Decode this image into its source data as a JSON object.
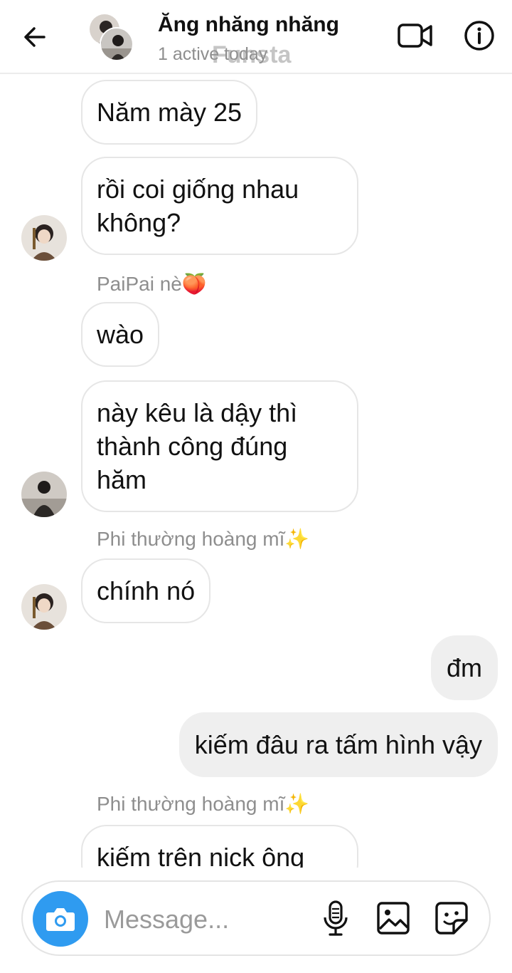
{
  "header": {
    "title": "Ăng nhăng nhăng",
    "status": "1 active today",
    "watermark": "Funsta",
    "icons": {
      "back": "arrow-left-icon",
      "video": "video-camera-icon",
      "info": "info-icon"
    }
  },
  "messages": [
    {
      "text_lines": [
        "Năm mày 25"
      ],
      "direction": "incoming"
    },
    {
      "text_lines": [
        "rồi coi giống nhau",
        "không?"
      ],
      "direction": "incoming"
    },
    {
      "sender": "PaiPai nè🍑"
    },
    {
      "text_lines": [
        "wào"
      ],
      "direction": "incoming"
    },
    {
      "text_lines": [
        "này kêu là dậy thì",
        "thành công đúng",
        "hăm"
      ],
      "direction": "incoming"
    },
    {
      "sender": "Phi thường hoàng mĩ✨"
    },
    {
      "text_lines": [
        "chính nó"
      ],
      "direction": "incoming"
    },
    {
      "text_lines": [
        "đm"
      ],
      "direction": "outgoing"
    },
    {
      "text_lines": [
        "kiếm đâu ra tấm hình vậy"
      ],
      "direction": "outgoing"
    },
    {
      "sender": "Phi thường hoàng mĩ✨"
    },
    {
      "text_lines": [
        "kiếm trên nick ông"
      ],
      "direction": "incoming"
    }
  ],
  "composer": {
    "placeholder": "Message...",
    "icons": {
      "camera": "camera-icon",
      "mic": "microphone-icon",
      "gallery": "image-icon",
      "sticker": "sticker-icon"
    }
  },
  "colors": {
    "camera_button": "#2f9bf0",
    "outgoing_bubble": "#efefef",
    "muted_text": "#8e8e8e"
  }
}
